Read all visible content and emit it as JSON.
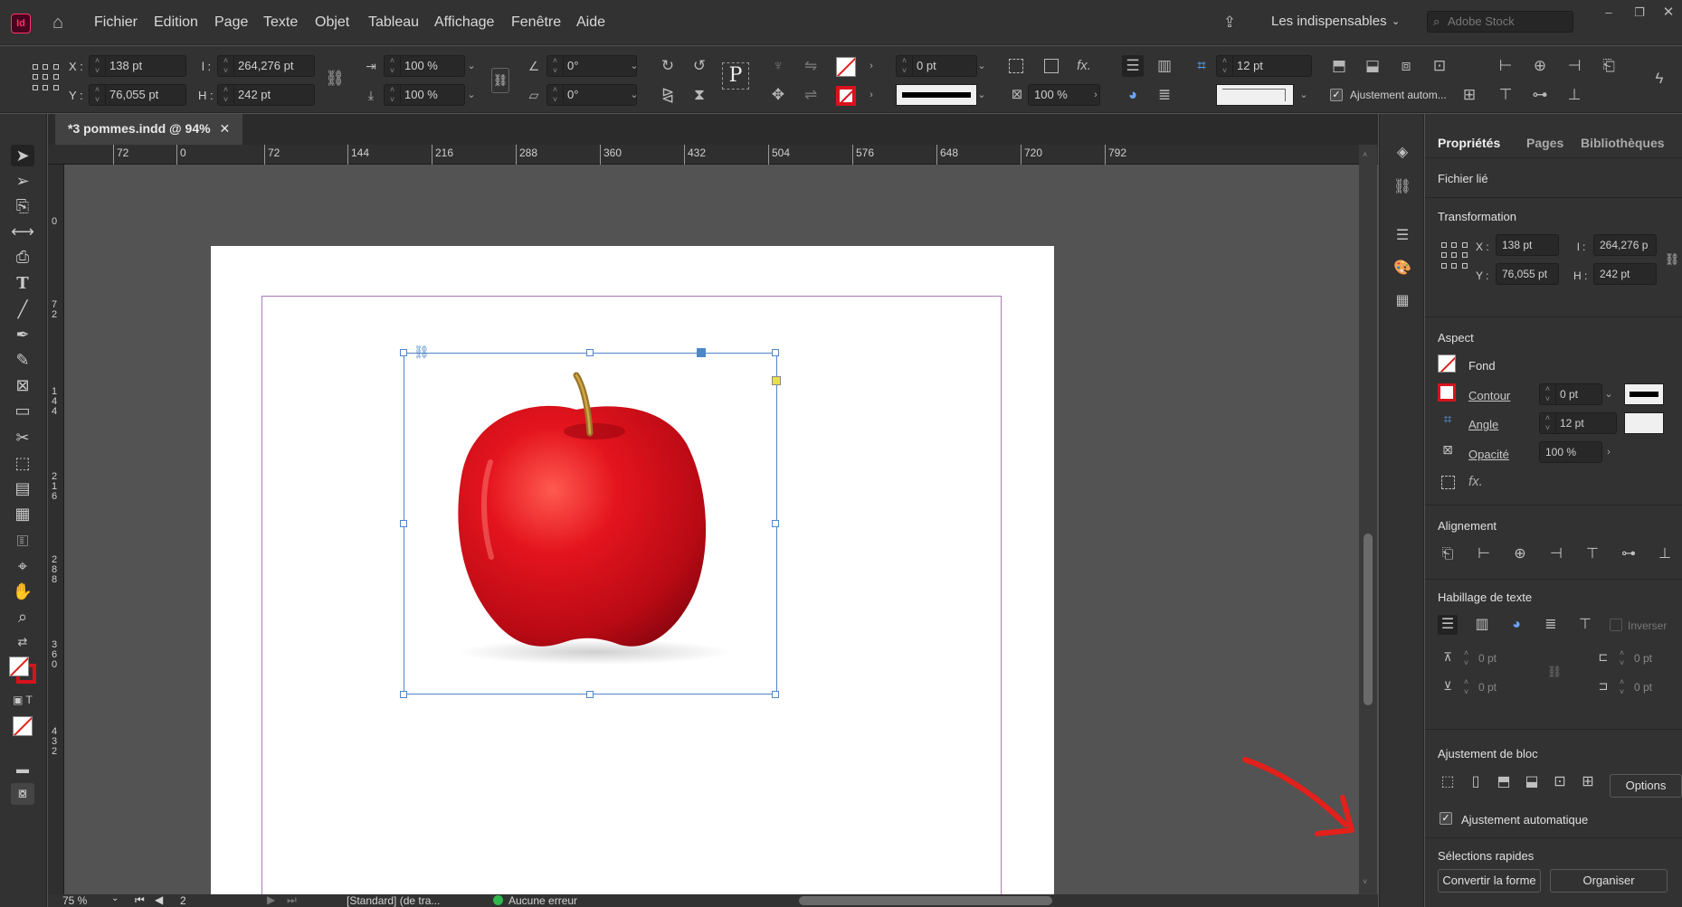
{
  "menubar": {
    "logo": "Id",
    "items": [
      "Fichier",
      "Edition",
      "Page",
      "Texte",
      "Objet",
      "Tableau",
      "Affichage",
      "Fenêtre",
      "Aide"
    ],
    "workspace": "Les indispensables",
    "search_placeholder": "Adobe Stock"
  },
  "control": {
    "x_label": "X :",
    "x": "138 pt",
    "y_label": "Y :",
    "y": "76,055 pt",
    "w_label": "l :",
    "w": "264,276 pt",
    "h_label": "H :",
    "h": "242 pt",
    "scale_x": "100 %",
    "scale_y": "100 %",
    "rotate": "0°",
    "shear": "0°",
    "stroke_weight": "0 pt",
    "opacity": "100 %",
    "corner": "12 pt",
    "auto_fit": "Ajustement autom..."
  },
  "document": {
    "tab": "*3 pommes.indd @ 94%",
    "hruler_labels": [
      "72",
      "0",
      "72",
      "144",
      "216",
      "288",
      "360",
      "432",
      "504",
      "576",
      "648",
      "720",
      "792"
    ],
    "vruler_labels": [
      "0",
      "72",
      "144",
      "216",
      "288",
      "360",
      "432"
    ]
  },
  "status": {
    "zoom": "75 %",
    "page": "2",
    "style": "[Standard] (de tra...",
    "errors": "Aucune erreur"
  },
  "panel": {
    "tabs": [
      "Propriétés",
      "Pages",
      "Bibliothèques"
    ],
    "linked_file": "Fichier lié",
    "transformation": "Transformation",
    "x_label": "X :",
    "x": "138 pt",
    "y_label": "Y :",
    "y": "76,055 pt",
    "w_label": "l :",
    "w": "264,276 p",
    "h_label": "H :",
    "h": "242 pt",
    "aspect": "Aspect",
    "fill": "Fond",
    "stroke": "Contour",
    "stroke_weight": "0 pt",
    "corner": "Angle",
    "corner_value": "12 pt",
    "opacity": "Opacité",
    "opacity_value": "100 %",
    "fx": "fx.",
    "alignment": "Alignement",
    "text_wrap": "Habillage de texte",
    "invert": "Inverser",
    "wrap_top": "0 pt",
    "wrap_bottom": "0 pt",
    "wrap_left": "0 pt",
    "wrap_right": "0 pt",
    "frame_fitting": "Ajustement de bloc",
    "options": "Options",
    "auto_fit": "Ajustement automatique",
    "quick_actions": "Sélections rapides",
    "convert_shape": "Convertir la forme",
    "arrange": "Organiser"
  },
  "colors": {
    "accent": "#4f86c6",
    "annotation_arrow": "#e3201b",
    "apple": "#d8121c"
  }
}
